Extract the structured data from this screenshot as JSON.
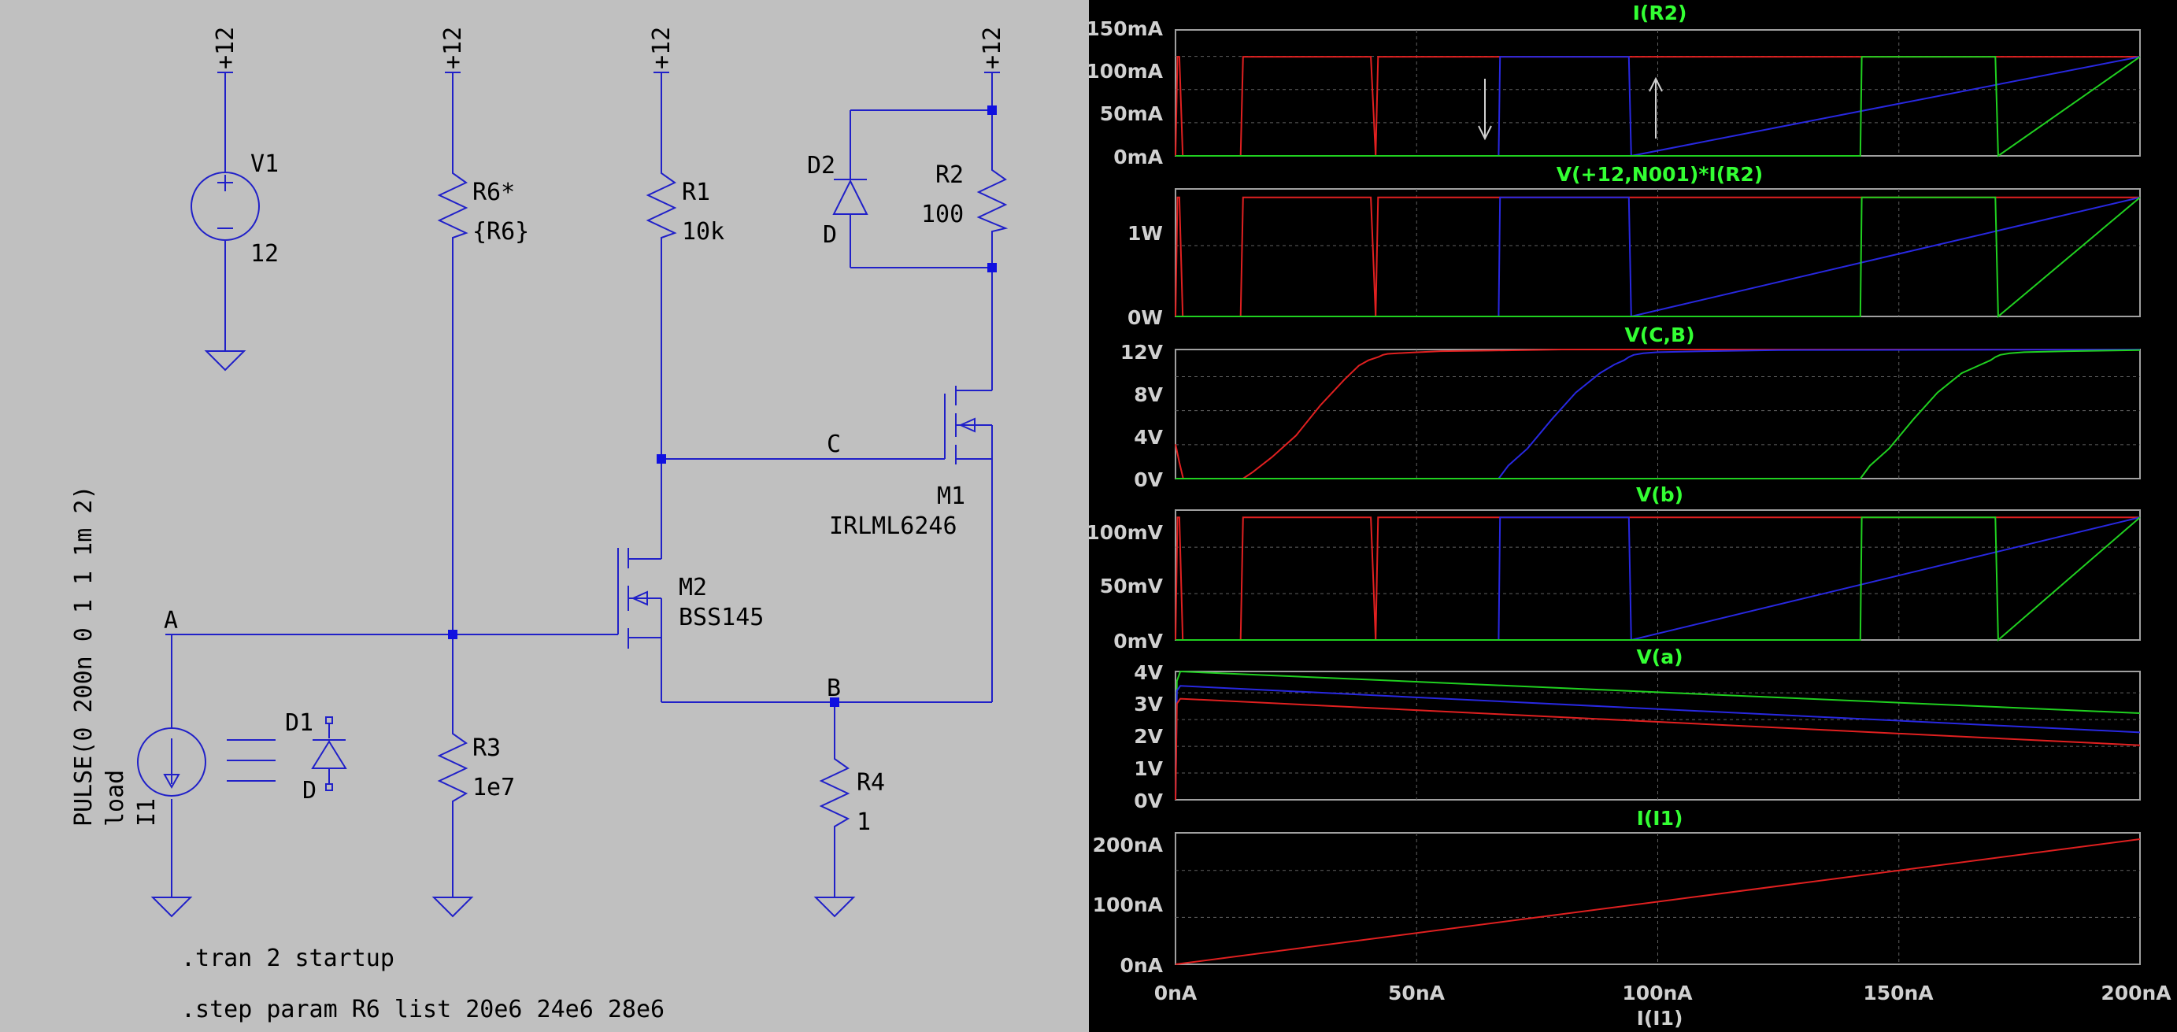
{
  "colors": {
    "schematic_bg": "#c0c0c0",
    "wire": "#2020c8",
    "junction": "#1010e0",
    "schem_text": "#000000",
    "plot_bg": "#000000",
    "plot_frame": "#a0a0a0",
    "grid": "#606060",
    "trace_title": "#33ff33",
    "axis_label": "#d0d0d0",
    "step1": "#e02020",
    "step2": "#2828e0",
    "step3": "#20d020"
  },
  "schematic": {
    "nets": {
      "vcc1": "+12",
      "vcc2": "+12",
      "vcc3": "+12",
      "vcc4": "+12",
      "A": "A",
      "B": "B",
      "C": "C"
    },
    "components": {
      "V1": {
        "name": "V1",
        "value": "12"
      },
      "R6": {
        "name": "R6*",
        "value": "{R6}"
      },
      "R1": {
        "name": "R1",
        "value": "10k"
      },
      "R2": {
        "name": "R2",
        "value": "100"
      },
      "D2": {
        "name": "D2",
        "value": "D"
      },
      "M1": {
        "name": "M1",
        "value": "IRLML6246"
      },
      "M2": {
        "name": "M2",
        "value": "BSS145"
      },
      "R3": {
        "name": "R3",
        "value": "1e7"
      },
      "R4": {
        "name": "R4",
        "value": "1"
      },
      "D1": {
        "name": "D1",
        "value": "D"
      },
      "I1": {
        "name": "I1",
        "load": "load",
        "value": "PULSE(0 200n 0 1 1 1m 2)"
      }
    },
    "directives": {
      "tran": ".tran 2 startup",
      "step": ".step param R6 list 20e6 24e6 28e6"
    }
  },
  "waveform": {
    "x_axis": {
      "label": "I(I1)",
      "ticks": [
        "0nA",
        "50nA",
        "100nA",
        "150nA",
        "200nA"
      ]
    },
    "pane1": {
      "title": "I(R2)",
      "y_ticks": [
        "150mA",
        "100mA",
        "50mA",
        "0mA"
      ]
    },
    "pane2": {
      "title": "V(+12,N001)*I(R2)",
      "y_ticks": [
        "1W",
        "0W"
      ]
    },
    "pane3": {
      "title": "V(C,B)",
      "y_ticks": [
        "12V",
        "8V",
        "4V",
        "0V"
      ]
    },
    "pane4": {
      "title": "V(b)",
      "y_ticks": [
        "100mV",
        "50mV",
        "0mV"
      ]
    },
    "pane5": {
      "title": "V(a)",
      "y_ticks": [
        "4V",
        "3V",
        "2V",
        "1V",
        "0V"
      ]
    },
    "pane6": {
      "title": "I(I1)",
      "y_ticks": [
        "200nA",
        "100nA",
        "0nA"
      ]
    }
  },
  "chart_data": {
    "type": "line",
    "x_label": "I(I1)",
    "x_unit": "nA",
    "xlim": [
      0,
      200
    ],
    "steps": [
      "R6=20e6",
      "R6=24e6",
      "R6=28e6"
    ],
    "panes": [
      {
        "title": "I(R2)",
        "ylim": [
          0,
          150
        ],
        "unit": "mA",
        "series": [
          {
            "color": "#e02020",
            "x": [
              0,
              0.4,
              0.8,
              1.5,
              13.5,
              14,
              14.5,
              40.5,
              41.5,
              42,
              200
            ],
            "y": [
              0,
              118,
              118,
              0,
              0,
              118,
              118,
              118,
              0,
              118,
              118
            ]
          },
          {
            "color": "#2828e0",
            "x": [
              0,
              67,
              67.3,
              94,
              94.5,
              200
            ],
            "y": [
              0,
              0,
              118,
              118,
              0,
              118
            ]
          },
          {
            "color": "#20d020",
            "x": [
              0,
              142,
              142.3,
              170,
              170.6,
              200
            ],
            "y": [
              0,
              0,
              118,
              118,
              0,
              118
            ]
          }
        ]
      },
      {
        "title": "V(+12,N001)*I(R2)",
        "ylim": [
          0,
          1.5
        ],
        "unit": "W",
        "series": [
          {
            "color": "#e02020",
            "x": [
              0,
              0.4,
              0.8,
              1.5,
              13.5,
              14,
              14.5,
              40.5,
              41.5,
              42,
              200
            ],
            "y": [
              0,
              1.4,
              1.4,
              0,
              0,
              1.4,
              1.4,
              1.4,
              0,
              1.4,
              1.4
            ]
          },
          {
            "color": "#2828e0",
            "x": [
              0,
              67,
              67.3,
              94,
              94.5,
              200
            ],
            "y": [
              0,
              0,
              1.4,
              1.4,
              0,
              1.4
            ]
          },
          {
            "color": "#20d020",
            "x": [
              0,
              142,
              142.3,
              170,
              170.6,
              200
            ],
            "y": [
              0,
              0,
              1.4,
              1.4,
              0,
              1.4
            ]
          }
        ]
      },
      {
        "title": "V(C,B)",
        "ylim": [
          0,
          12
        ],
        "unit": "V",
        "series": [
          {
            "color": "#e02020",
            "x": [
              0,
              0.8,
              1.6,
              14,
              16,
              20,
              25,
              30,
              35,
              38,
              40,
              42,
              43,
              44,
              48,
              55,
              65,
              80,
              200
            ],
            "y": [
              3.2,
              1.5,
              0,
              0,
              0.6,
              2.0,
              4.0,
              6.8,
              9.2,
              10.5,
              11.0,
              11.3,
              11.5,
              11.6,
              11.7,
              11.85,
              11.9,
              12,
              12
            ]
          },
          {
            "color": "#2828e0",
            "x": [
              0,
              67,
              69,
              73,
              78,
              83,
              88,
              91,
              93,
              94,
              95,
              97,
              100,
              110,
              125,
              200
            ],
            "y": [
              0,
              0,
              1.2,
              2.8,
              5.5,
              8.0,
              9.8,
              10.6,
              11.0,
              11.3,
              11.5,
              11.65,
              11.75,
              11.85,
              11.95,
              12
            ]
          },
          {
            "color": "#20d020",
            "x": [
              0,
              142,
              144,
              148,
              153,
              158,
              163,
              167,
              169,
              170,
              171,
              173,
              176,
              185,
              200
            ],
            "y": [
              0,
              0,
              1.2,
              2.8,
              5.5,
              8.0,
              9.8,
              10.6,
              11.0,
              11.3,
              11.5,
              11.65,
              11.75,
              11.85,
              11.95
            ]
          }
        ]
      },
      {
        "title": "V(b)",
        "ylim": [
          0,
          125
        ],
        "unit": "mV",
        "series": [
          {
            "color": "#e02020",
            "x": [
              0,
              0.4,
              0.8,
              1.5,
              13.5,
              14,
              14.5,
              40.5,
              41.5,
              42,
              200
            ],
            "y": [
              0,
              118,
              118,
              0,
              0,
              118,
              118,
              118,
              0,
              118,
              118
            ]
          },
          {
            "color": "#2828e0",
            "x": [
              0,
              67,
              67.3,
              94,
              94.5,
              200
            ],
            "y": [
              0,
              0,
              118,
              118,
              0,
              118
            ]
          },
          {
            "color": "#20d020",
            "x": [
              0,
              142,
              142.3,
              170,
              170.6,
              200
            ],
            "y": [
              0,
              0,
              118,
              118,
              0,
              118
            ]
          }
        ]
      },
      {
        "title": "V(a)",
        "ylim": [
          0,
          4
        ],
        "unit": "V",
        "series": [
          {
            "color": "#20d020",
            "x": [
              0,
              0.3,
              1,
              200
            ],
            "y": [
              0,
              3.7,
              4.0,
              2.7
            ]
          },
          {
            "color": "#2828e0",
            "x": [
              0,
              0.3,
              1,
              200
            ],
            "y": [
              0,
              3.4,
              3.55,
              2.1
            ]
          },
          {
            "color": "#e02020",
            "x": [
              0,
              0.3,
              1,
              200
            ],
            "y": [
              0,
              3.0,
              3.15,
              1.7
            ]
          }
        ]
      },
      {
        "title": "I(I1)",
        "ylim": [
          0,
          210
        ],
        "unit": "nA",
        "series": [
          {
            "color": "#e02020",
            "x": [
              0,
              200
            ],
            "y": [
              0,
              200
            ]
          }
        ]
      }
    ]
  }
}
